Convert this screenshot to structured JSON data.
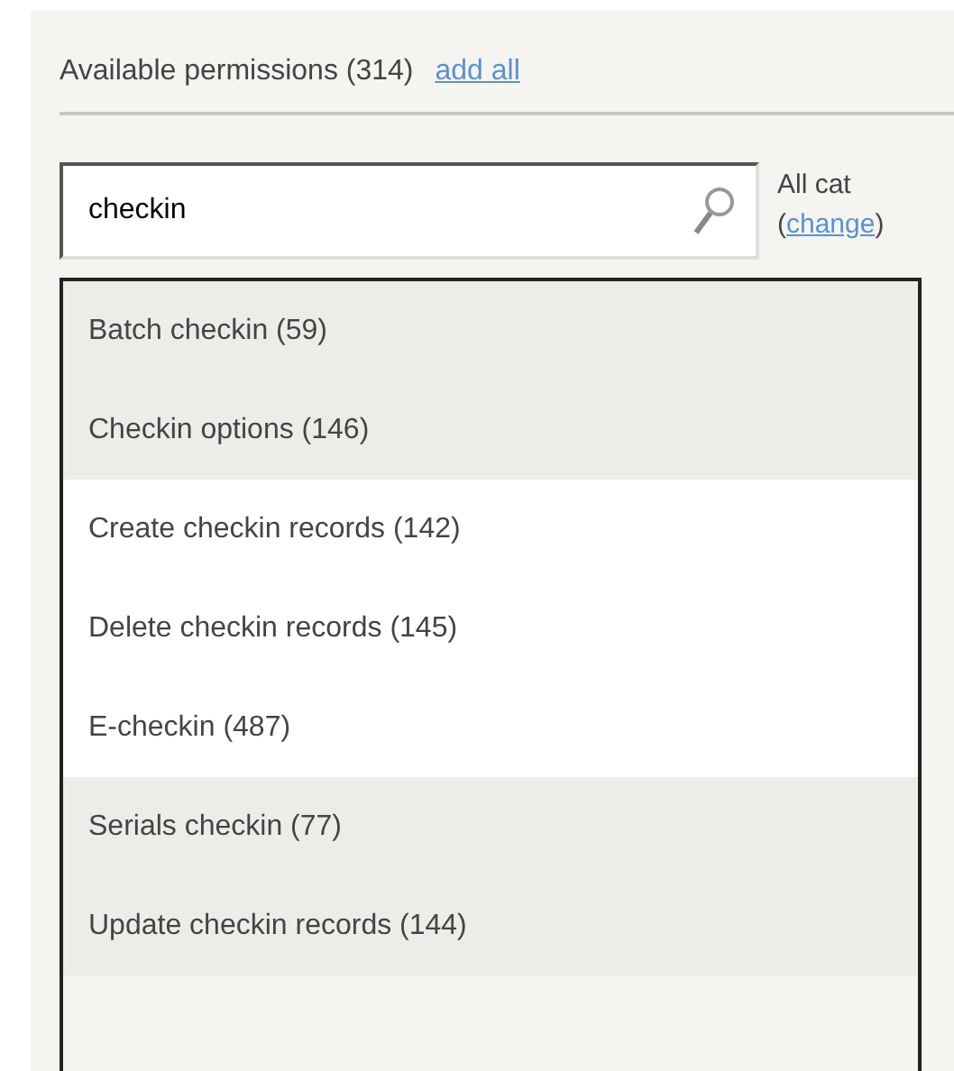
{
  "header": {
    "title": "Available permissions (314)",
    "link": "add all"
  },
  "search": {
    "value": "checkin"
  },
  "category": {
    "label": "All cat",
    "open_paren": "(",
    "link": "change",
    "close_paren": ")"
  },
  "results": [
    {
      "label": "Batch checkin (59)",
      "highlighted": true
    },
    {
      "label": "Checkin options (146)",
      "highlighted": true
    },
    {
      "label": "Create checkin records (142)",
      "highlighted": false
    },
    {
      "label": "Delete checkin records (145)",
      "highlighted": false
    },
    {
      "label": "E-checkin (487)",
      "highlighted": false
    },
    {
      "label": "Serials checkin (77)",
      "highlighted": true
    },
    {
      "label": "Update checkin records (144)",
      "highlighted": true
    }
  ]
}
